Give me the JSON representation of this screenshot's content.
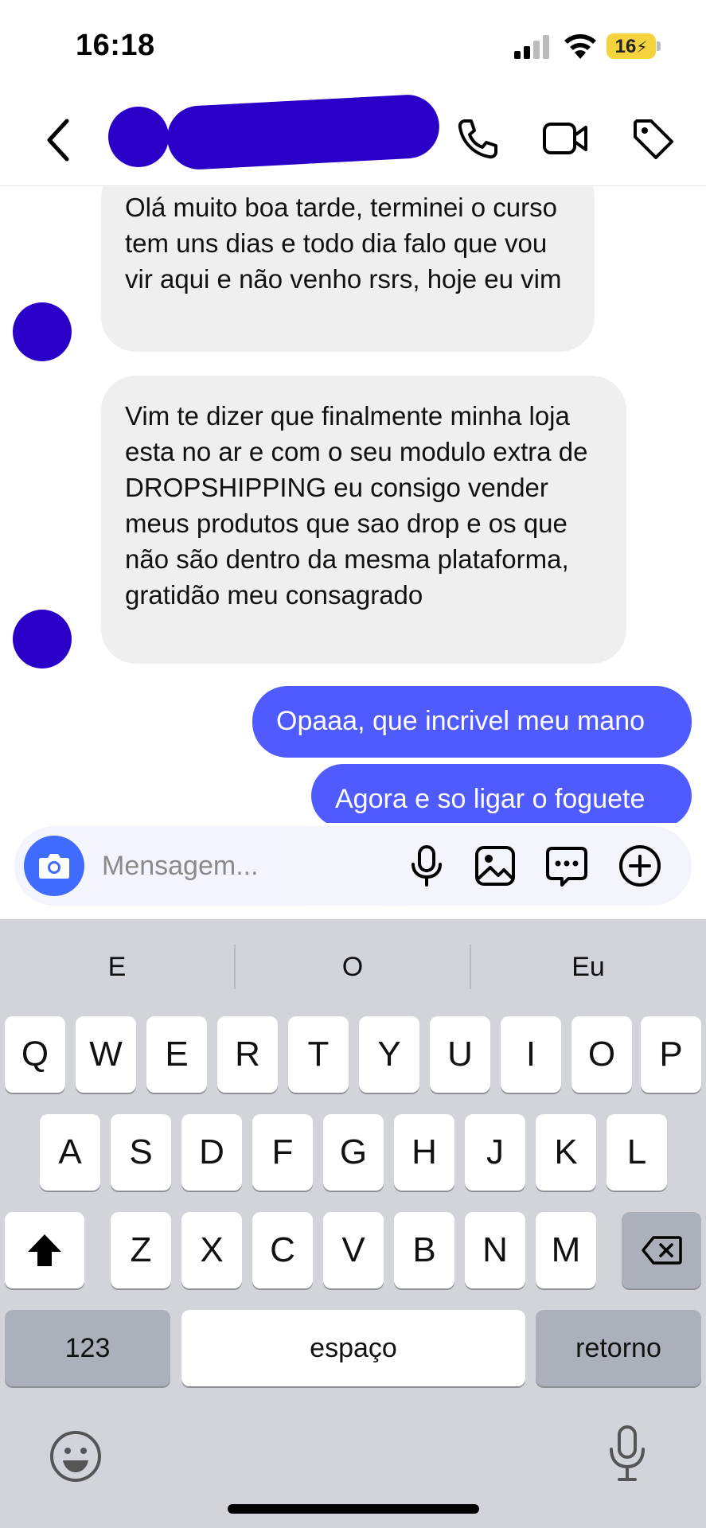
{
  "status_bar": {
    "time": "16:18",
    "battery": "16"
  },
  "header": {
    "back_icon": "chevron-left-icon",
    "call_icon": "phone-icon",
    "video_icon": "video-camera-icon",
    "tag_icon": "tag-icon"
  },
  "messages": {
    "incoming": [
      {
        "text": "Olá muito boa tarde, terminei o curso tem uns dias e todo dia falo que vou vir aqui e não venho rsrs, hoje eu vim"
      },
      {
        "text": "Vim te dizer que finalmente minha loja esta no ar e com o seu modulo extra de DROPSHIPPING eu consigo vender meus produtos que sao drop e os que não são dentro da mesma plataforma, gratidão meu consagrado"
      }
    ],
    "outgoing": [
      {
        "text": "Opaaa, que incrivel meu mano"
      },
      {
        "text": "Agora e so ligar o foguete"
      }
    ]
  },
  "composer": {
    "placeholder": "Mensagem..."
  },
  "keyboard": {
    "suggestions": [
      "E",
      "O",
      "Eu"
    ],
    "row1": [
      "Q",
      "W",
      "E",
      "R",
      "T",
      "Y",
      "U",
      "I",
      "O",
      "P"
    ],
    "row2": [
      "A",
      "S",
      "D",
      "F",
      "G",
      "H",
      "J",
      "K",
      "L"
    ],
    "row3": [
      "Z",
      "X",
      "C",
      "V",
      "B",
      "N",
      "M"
    ],
    "numbers_label": "123",
    "space_label": "espaço",
    "return_label": "retorno"
  },
  "colors": {
    "accent": "#4f5bff",
    "redaction": "#2a00c8",
    "battery": "#f4d33c"
  }
}
